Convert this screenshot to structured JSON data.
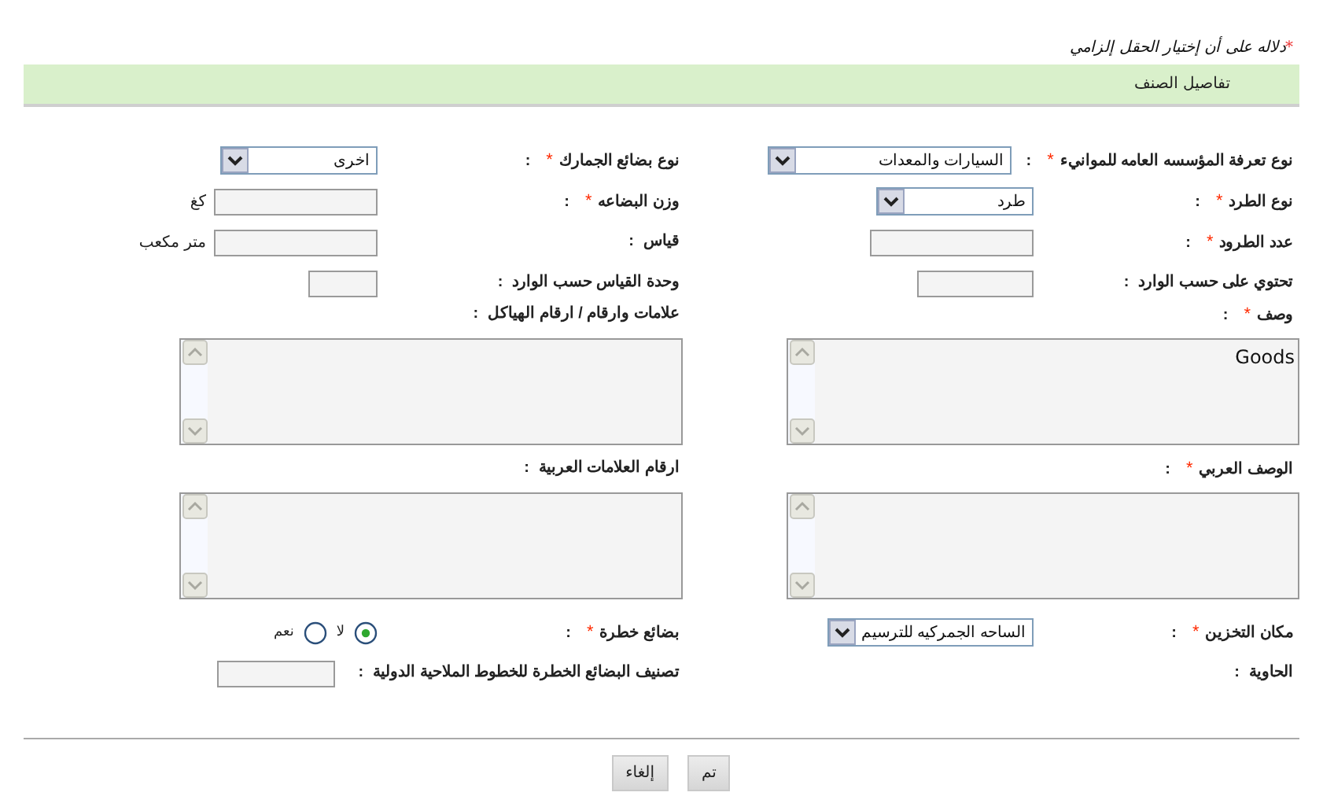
{
  "note": {
    "mark": "*",
    "text": "دلاله على أن إختيار الحقل إلزامي"
  },
  "required_mark": "*",
  "section": {
    "title": "تفاصيل الصنف"
  },
  "rows": [
    {
      "fields": [
        {
          "label": "نوع تعرفة المؤسسه العامه للموانيء",
          "required": true,
          "colon": ":",
          "control": {
            "kind": "select",
            "value": "السيارات والمعدات"
          }
        },
        {
          "label": "نوع بضائع الجمارك",
          "required": true,
          "colon": ":",
          "control": {
            "kind": "select",
            "value": "اخرى"
          }
        }
      ]
    },
    {
      "fields": [
        {
          "label": "نوع الطرد",
          "required": true,
          "colon": ":",
          "control": {
            "kind": "select",
            "value": "طرد"
          }
        },
        {
          "label": "وزن البضاعه",
          "required": true,
          "colon": ":",
          "control": {
            "kind": "text",
            "unit": "كغ"
          }
        }
      ]
    },
    {
      "fields": [
        {
          "label": "عدد الطرود",
          "required": true,
          "colon": ":",
          "control": {
            "kind": "text"
          }
        },
        {
          "label": "قياس",
          "required": false,
          "colon": ":",
          "control": {
            "kind": "text",
            "unit": "متر مكعب"
          }
        }
      ]
    },
    {
      "fields": [
        {
          "label": "تحتوي على حسب الوارد",
          "required": false,
          "colon": ":",
          "control": {
            "kind": "text"
          }
        },
        {
          "label": "وحدة القياس حسب الوارد",
          "required": false,
          "colon": ":",
          "control": {
            "kind": "text"
          }
        }
      ]
    },
    {
      "fields": [
        {
          "label": "وصف",
          "required": true,
          "colon": ":",
          "control": {
            "kind": "textarea",
            "value": "Goods"
          }
        },
        {
          "label": "علامات وارقام / ارقام الهياكل",
          "required": false,
          "colon": ":",
          "control": {
            "kind": "textarea"
          }
        }
      ]
    },
    {
      "fields": [
        {
          "label": "الوصف العربي",
          "required": true,
          "colon": ":",
          "control": {
            "kind": "textarea"
          }
        },
        {
          "label": "ارقام العلامات العربية",
          "required": false,
          "colon": ":",
          "control": {
            "kind": "textarea"
          }
        }
      ]
    },
    {
      "fields": [
        {
          "label": "مكان التخزين",
          "required": true,
          "colon": ":",
          "control": {
            "kind": "select",
            "value": "الساحه الجمركيه للترسيم"
          }
        },
        {
          "label": "بضائع خطرة",
          "required": true,
          "colon": ":",
          "control": {
            "kind": "radio",
            "options": [
              {
                "label": "لا",
                "selected": true
              },
              {
                "label": "نعم",
                "selected": false
              }
            ]
          }
        }
      ]
    },
    {
      "fields": [
        {
          "label": "الحاوية",
          "required": false,
          "colon": ":"
        },
        {
          "label": "تصنيف البضائع الخطرة للخطوط الملاحية الدولية",
          "required": false,
          "colon": ":",
          "control": {
            "kind": "text"
          }
        }
      ]
    }
  ],
  "buttons": [
    {
      "label": "تم"
    },
    {
      "label": "إلغاء"
    }
  ]
}
